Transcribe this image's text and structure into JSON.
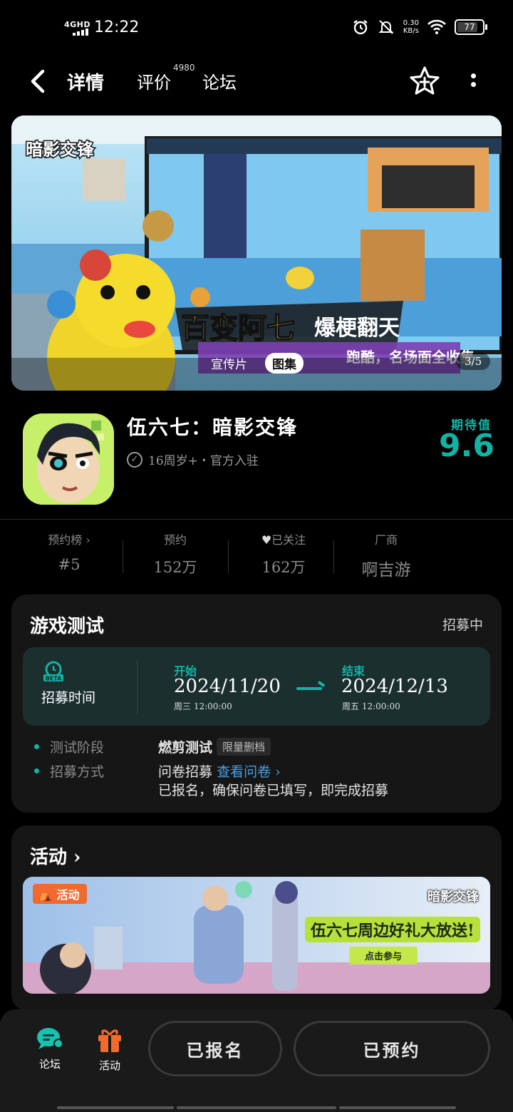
{
  "status_bar": {
    "network": "4GHD",
    "time": "12:22",
    "speed_value": "0.30",
    "speed_unit": "KB/s",
    "battery": "77"
  },
  "nav": {
    "tab_detail": "详情",
    "tab_review": "评价",
    "review_count": "4980",
    "tab_forum": "论坛"
  },
  "banner": {
    "tab_video": "宣传片",
    "tab_gallery": "图集",
    "counter": "3/5",
    "logo_text": "暗影交锋",
    "headline_1": "百变阿七",
    "headline_2": "爆梗翻天",
    "headline_3": "跑酷，名场面全收集"
  },
  "game": {
    "title": "伍六七：暗影交锋",
    "meta": "16周岁+・官方入驻",
    "expect_label": "期待值",
    "expect_score": "9.6"
  },
  "stats": [
    {
      "label": "预约榜 ›",
      "value": "#5"
    },
    {
      "label": "预约",
      "value": "152万"
    },
    {
      "label": "已关注",
      "value": "162万"
    },
    {
      "label": "厂商",
      "value": "啊吉游"
    }
  ],
  "test": {
    "title": "游戏测试",
    "status": "招募中",
    "recruit_time_label": "招募时间",
    "start_label": "开始",
    "start_date": "2024/11/20",
    "start_sub": "周三 12:00:00",
    "end_label": "结束",
    "end_date": "2024/12/13",
    "end_sub": "周五 12:00:00",
    "stage_label": "测试阶段",
    "stage_name": "燃剪测试",
    "stage_tag": "限量删档",
    "method_label": "招募方式",
    "method_value": "问卷招募",
    "method_link": "查看问卷 ›",
    "method_note": "已报名，确保问卷已填写，即完成招募"
  },
  "activity": {
    "title": "活动 ›",
    "badge": "活动",
    "banner_logo": "暗影交锋",
    "banner_title": "伍六七周边好礼大放送!",
    "banner_button": "点击参与"
  },
  "bottom": {
    "forum_label": "论坛",
    "activity_label": "活动",
    "signed_button": "已报名",
    "reserved_button": "已预约"
  },
  "colors": {
    "accent": "#12b3a5",
    "link": "#4aa0e6",
    "background": "#000000",
    "card": "#161616"
  }
}
